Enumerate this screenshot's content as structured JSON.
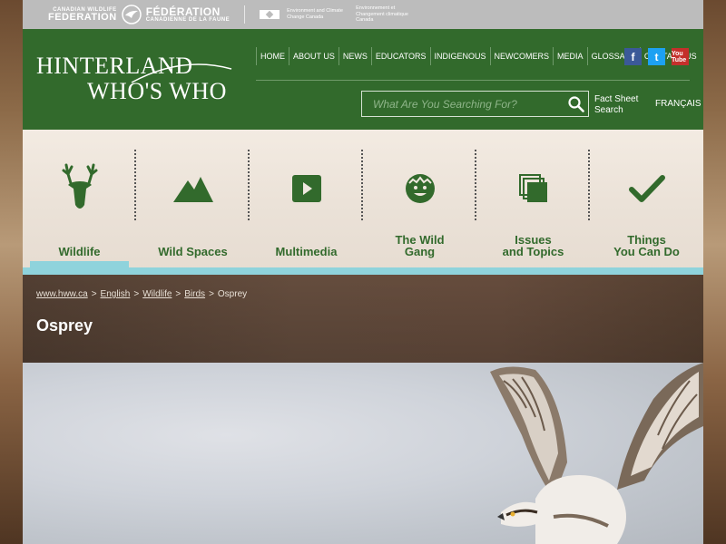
{
  "partners": {
    "cwf_en_small": "CANADIAN WILDLIFE",
    "cwf_en_big": "FEDERATION",
    "cwf_fr_big": "FÉDÉRATION",
    "cwf_fr_small": "CANADIENNE DE LA FAUNE",
    "eccc_en": "Environment and Climate Change Canada",
    "eccc_fr": "Environnement et Changement climatique Canada"
  },
  "logo": {
    "line1": "HINTERLAND",
    "line2": "WHO'S WHO"
  },
  "topnav": [
    "HOME",
    "ABOUT US",
    "NEWS",
    "EDUCATORS",
    "INDIGENOUS",
    "NEWCOMERS",
    "MEDIA",
    "GLOSSARY",
    "CONTACT US"
  ],
  "social": {
    "facebook": "f",
    "twitter": "t",
    "youtube": "You Tube"
  },
  "search": {
    "placeholder": "What Are You Searching For?",
    "fact_sheet_line1": "Fact Sheet",
    "fact_sheet_line2": "Search"
  },
  "language": "FRANÇAIS",
  "mainnav": [
    {
      "label": "Wildlife",
      "icon": "deer-icon",
      "active": true
    },
    {
      "label": "Wild Spaces",
      "icon": "mountain-icon",
      "active": false
    },
    {
      "label": "Multimedia",
      "icon": "play-icon",
      "active": false
    },
    {
      "label": "The Wild\nGang",
      "icon": "face-icon",
      "active": false
    },
    {
      "label": "Issues\nand Topics",
      "icon": "stack-icon",
      "active": false
    },
    {
      "label": "Things\nYou Can Do",
      "icon": "checkmark-icon",
      "active": false
    }
  ],
  "breadcrumb": {
    "home": "www.hww.ca",
    "english": "English",
    "wildlife": "Wildlife",
    "birds": "Birds",
    "current": "Osprey",
    "sep": ">"
  },
  "page": {
    "title": "Osprey"
  },
  "colors": {
    "header_green": "#326a2c",
    "accent_cyan": "#8fd3dc",
    "partner_grey": "#bcbcbc"
  }
}
